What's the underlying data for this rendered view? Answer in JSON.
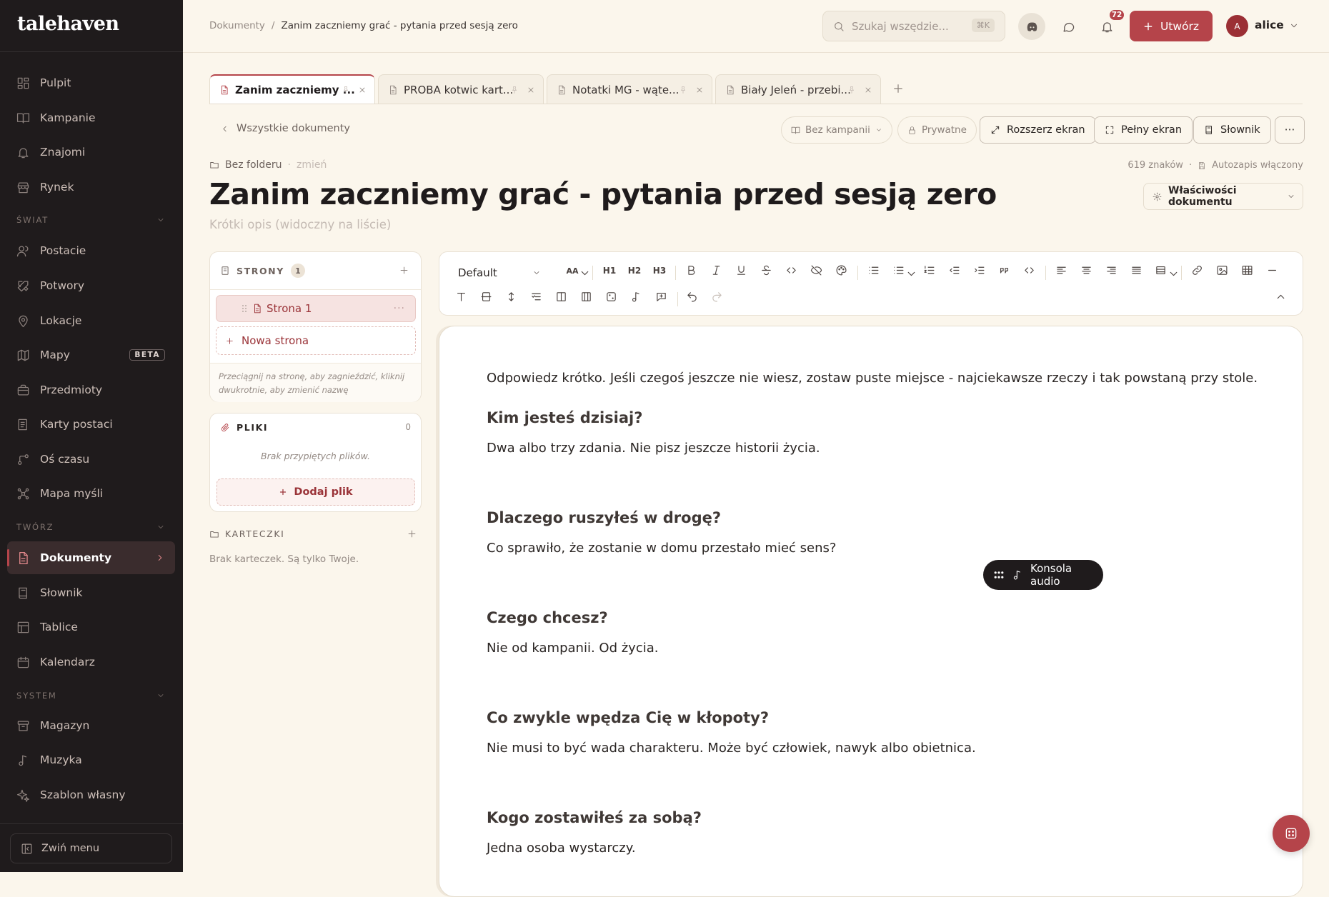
{
  "app": {
    "name": "talehaven"
  },
  "sidebar": {
    "items_top": [
      {
        "label": "Pulpit",
        "icon": "dashboard-icon"
      },
      {
        "label": "Kampanie",
        "icon": "book-icon"
      },
      {
        "label": "Znajomi",
        "icon": "bell-icon"
      },
      {
        "label": "Rynek",
        "icon": "store-icon"
      }
    ],
    "section_world": "ŚWIAT",
    "items_world": [
      {
        "label": "Postacie",
        "icon": "users-icon"
      },
      {
        "label": "Potwory",
        "icon": "swords-icon"
      },
      {
        "label": "Lokacje",
        "icon": "pin-icon"
      },
      {
        "label": "Mapy",
        "icon": "map-icon",
        "badge": "BETA"
      },
      {
        "label": "Przedmioty",
        "icon": "bag-icon"
      },
      {
        "label": "Karty postaci",
        "icon": "sheet-icon"
      },
      {
        "label": "Oś czasu",
        "icon": "timeline-icon"
      },
      {
        "label": "Mapa myśli",
        "icon": "mindmap-icon"
      }
    ],
    "section_create": "TWÓRZ",
    "items_create": [
      {
        "label": "Dokumenty",
        "icon": "document-icon",
        "active": true
      },
      {
        "label": "Słownik",
        "icon": "glossary-icon"
      },
      {
        "label": "Tablice",
        "icon": "board-icon"
      },
      {
        "label": "Kalendarz",
        "icon": "calendar-icon"
      }
    ],
    "section_system": "SYSTEM",
    "items_system": [
      {
        "label": "Magazyn",
        "icon": "archive-icon"
      },
      {
        "label": "Muzyka",
        "icon": "music-icon"
      },
      {
        "label": "Szablon własny",
        "icon": "sparkles-icon"
      }
    ],
    "collapse_label": "Zwiń menu"
  },
  "header": {
    "breadcrumb_root": "Dokumenty",
    "breadcrumb_sep": "/",
    "breadcrumb_current": "Zanim zaczniemy grać - pytania przed sesją zero",
    "search_placeholder": "Szukaj wszędzie...",
    "search_shortcut": "⌘K",
    "notifications_count": "72",
    "create_label": "Utwórz",
    "avatar_initial": "A",
    "username": "alice"
  },
  "tabs": [
    {
      "label": "Zanim zaczniemy ...",
      "active": true
    },
    {
      "label": "PROBA kotwic kart..."
    },
    {
      "label": "Notatki MG - wąte..."
    },
    {
      "label": "Biały Jeleń - przebi..."
    }
  ],
  "doc_toolbar": {
    "back_label": "Wszystkie dokumenty",
    "campaign_label": "Bez kampanii",
    "privacy_label": "Prywatne",
    "expand_label": "Rozszerz ekran",
    "fullscreen_label": "Pełny ekran",
    "glossary_label": "Słownik",
    "more_label": "⋯"
  },
  "document": {
    "folder": "Bez folderu",
    "folder_sep": "·",
    "change_label": "zmień",
    "char_count": "619 znaków",
    "meta_sep": "·",
    "autosave": "Autozapis włączony",
    "title": "Zanim zaczniemy grać - pytania przed sesją zero",
    "description_placeholder": "Krótki opis (widoczny na liście)",
    "properties_label": "Właściwości dokumentu"
  },
  "pages_panel": {
    "title": "STRONY",
    "count": "1",
    "pages": [
      {
        "label": "Strona 1"
      }
    ],
    "more": "···",
    "new_page": "Nowa strona",
    "hint": "Przeciągnij na stronę, aby zagnieździć, kliknij dwukrotnie, aby zmienić nazwę"
  },
  "files_panel": {
    "title": "PLIKI",
    "count": "0",
    "empty": "Brak przypiętych plików.",
    "add_label": "Dodaj plik"
  },
  "cards_panel": {
    "title": "KARTECZKI",
    "empty": "Brak karteczek. Są tylko Twoje."
  },
  "editor_toolbar": {
    "style_value": "Default",
    "font_size_label": "AA",
    "h1": "H1",
    "h2": "H2",
    "h3": "H3"
  },
  "editor": {
    "intro": "Odpowiedz krótko. Jeśli czegoś jeszcze nie wiesz, zostaw puste miejsce - najciekawsze rzeczy i tak powstaną przy stole.",
    "blocks": [
      {
        "heading": "Kim jesteś dzisiaj?",
        "text": "Dwa albo trzy zdania. Nie pisz jeszcze historii życia."
      },
      {
        "heading": "Dlaczego ruszyłeś w drogę?",
        "text": "Co sprawiło, że zostanie w domu przestało mieć sens?"
      },
      {
        "heading": "Czego chcesz?",
        "text": "Nie od kampanii. Od życia."
      },
      {
        "heading": "Co zwykle wpędza Cię w kłopoty?",
        "text": "Nie musi to być wada charakteru. Może być człowiek, nawyk albo obietnica."
      },
      {
        "heading": "Kogo zostawiłeś za sobą?",
        "text": "Jedna osoba wystarczy."
      }
    ]
  },
  "audio_console": {
    "label": "Konsola audio"
  },
  "colors": {
    "accent": "#b5444a",
    "sidebar_bg": "#1f1b1c",
    "page_bg": "#fbf6ec"
  }
}
